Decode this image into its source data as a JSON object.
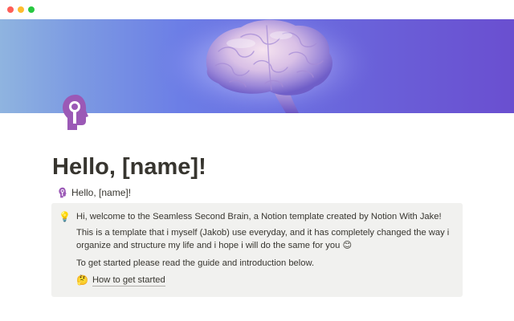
{
  "window": {
    "controls": [
      "close",
      "minimize",
      "maximize"
    ]
  },
  "cover": {
    "image": "brain-image",
    "colors": {
      "gradient_left": "#8fb4e0",
      "gradient_right": "#6a4fd0"
    }
  },
  "page": {
    "icon": "head-silhouette-icon",
    "icon_color": "#9b59b6",
    "title": "Hello, [name]!",
    "subpage_link": {
      "icon": "head-silhouette-icon",
      "label": "Hello, [name]!"
    }
  },
  "callout": {
    "icon": "💡",
    "lines": [
      "Hi, welcome to the Seamless Second Brain, a Notion template created by Notion With Jake!",
      "This is a template that i myself (Jakob) use everyday, and it has completely changed the way i",
      "organize and structure my life and i hope i will do the same for you 😊",
      "To get started please read the guide and introduction below."
    ],
    "link": {
      "emoji": "🤔",
      "label": "How to get started"
    },
    "background": "#f1f1ef"
  }
}
